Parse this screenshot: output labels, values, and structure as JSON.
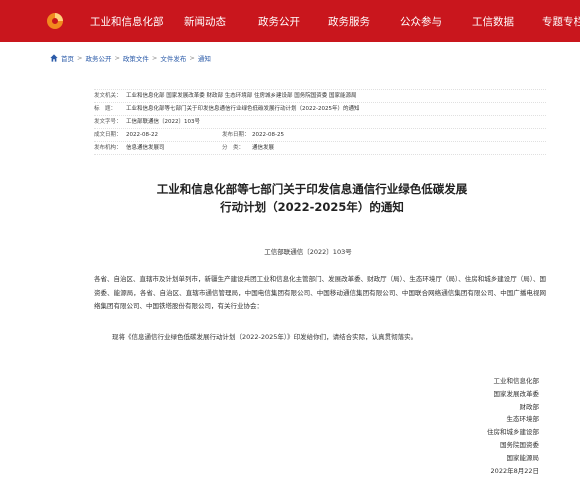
{
  "nav": {
    "items": [
      "工业和信息化部",
      "新闻动态",
      "政务公开",
      "政务服务",
      "公众参与",
      "工信数据",
      "专题专栏"
    ],
    "bg_color": "#c9161d"
  },
  "breadcrumb": [
    "首页",
    "政务公开",
    "政策文件",
    "文件发布",
    "通知"
  ],
  "meta": {
    "issuer_label": "发文机关：",
    "issuer": "工业和信息化部 国家发展改革委 财政部 生态环境部 住房城乡建设部 国务院国资委 国家能源局",
    "title_label": "标　题：",
    "title": "工业和信息化部等七部门关于印发信息通信行业绿色低碳发展行动计划（2022-2025年）的通知",
    "docnum_label": "发文字号：",
    "docnum": "工信部联通信〔2022〕103号",
    "written_label": "成文日期：",
    "written": "2022-08-22",
    "published_label": "发布日期：",
    "published": "2022-08-25",
    "org_label": "发布机构：",
    "org": "信息通信发展司",
    "category_label": "分　类：",
    "category": "通信发展"
  },
  "document": {
    "title_line1": "工业和信息化部等七部门关于印发信息通信行业绿色低碳发展",
    "title_line2": "行动计划（2022-2025年）的通知",
    "number": "工信部联通信〔2022〕103号",
    "recipients": "各省、自治区、直辖市及计划单列市，新疆生产建设兵团工业和信息化主管部门、发展改革委、财政厅（局）、生态环境厅（局）、住房和城乡建设厅（局）、国资委、能源局，各省、自治区、直辖市通信管理局，中国电信集团有限公司、中国移动通信集团有限公司、中国联合网络通信集团有限公司、中国广播电视网络集团有限公司、中国铁塔股份有限公司，有关行业协会：",
    "body": "现将《信息通信行业绿色低碳发展行动计划（2022-2025年）》印发给你们，请结合实际，认真贯彻落实。",
    "signers": [
      "工业和信息化部",
      "国家发展改革委",
      "财政部",
      "生态环境部",
      "住房和城乡建设部",
      "国务院国资委",
      "国家能源局",
      "2022年8月22日"
    ]
  }
}
